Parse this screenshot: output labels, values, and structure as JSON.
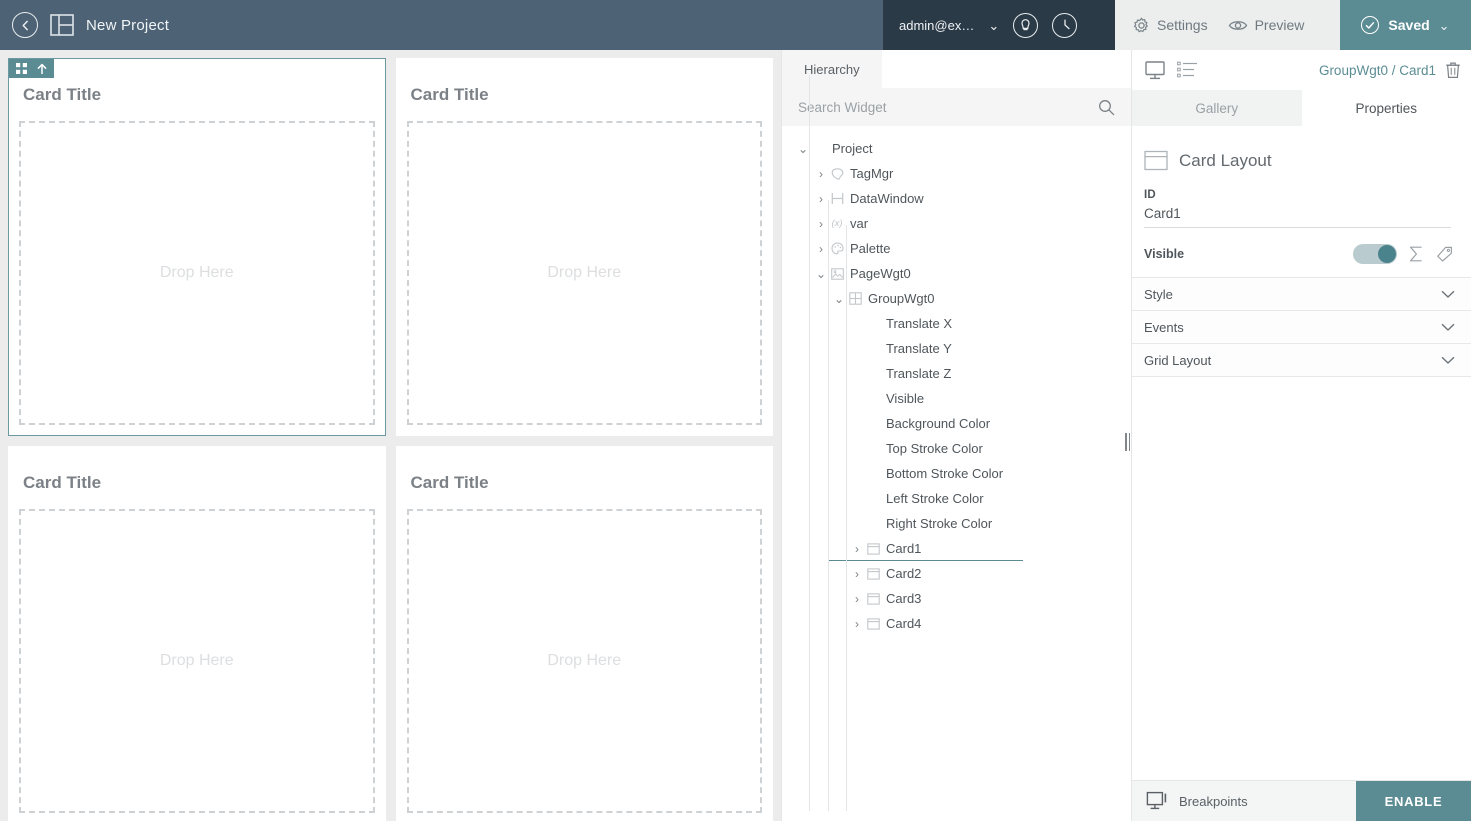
{
  "header": {
    "back_icon": "back-circle-icon",
    "layout_icon": "panel-layout-icon",
    "project_title": "New Project",
    "user_email": "admin@ex…",
    "user_chevron": "⌄",
    "help_icon": "help-circle-icon",
    "history_icon": "clock-icon",
    "settings_label": "Settings",
    "preview_label": "Preview",
    "saved_label": "Saved",
    "saved_chevron": "⌄",
    "colors": {
      "left_bar": "#4d6274",
      "user_bar": "#2b3a47",
      "tools_bar": "#eceded",
      "saved_bar": "#5b8c94"
    }
  },
  "canvas": {
    "background": "#ececec",
    "selection_color": "#5b8c94",
    "card_toolbar": {
      "move_icon": "move-resize-icon",
      "up_icon": "arrow-up-icon"
    },
    "cards": [
      {
        "title": "Card Title",
        "drop_text": "Drop Here",
        "selected": true
      },
      {
        "title": "Card Title",
        "drop_text": "Drop Here",
        "selected": false
      },
      {
        "title": "Card Title",
        "drop_text": "Drop Here",
        "selected": false
      },
      {
        "title": "Card Title",
        "drop_text": "Drop Here",
        "selected": false
      }
    ]
  },
  "hierarchy": {
    "tab_label": "Hierarchy",
    "search_placeholder": "Search Widget",
    "search_value": "",
    "search_icon": "search-icon",
    "tree": [
      {
        "label": "Project",
        "depth": 0,
        "arrow": "⌄",
        "icon": "none",
        "selected": false
      },
      {
        "label": "TagMgr",
        "depth": 1,
        "arrow": "›",
        "icon": "tag-icon",
        "selected": false
      },
      {
        "label": "DataWindow",
        "depth": 1,
        "arrow": "›",
        "icon": "window-icon",
        "selected": false
      },
      {
        "label": "var",
        "depth": 1,
        "arrow": "›",
        "icon": "var-icon",
        "selected": false
      },
      {
        "label": "Palette",
        "depth": 1,
        "arrow": "›",
        "icon": "palette-icon",
        "selected": false
      },
      {
        "label": "PageWgt0",
        "depth": 1,
        "arrow": "⌄",
        "icon": "page-icon",
        "selected": false
      },
      {
        "label": "GroupWgt0",
        "depth": 2,
        "arrow": "⌄",
        "icon": "grid-icon",
        "selected": false
      },
      {
        "label": "Translate X",
        "depth": 3,
        "arrow": "",
        "icon": "none",
        "selected": false
      },
      {
        "label": "Translate Y",
        "depth": 3,
        "arrow": "",
        "icon": "none",
        "selected": false
      },
      {
        "label": "Translate Z",
        "depth": 3,
        "arrow": "",
        "icon": "none",
        "selected": false
      },
      {
        "label": "Visible",
        "depth": 3,
        "arrow": "",
        "icon": "none",
        "selected": false
      },
      {
        "label": "Background Color",
        "depth": 3,
        "arrow": "",
        "icon": "none",
        "selected": false
      },
      {
        "label": "Top Stroke Color",
        "depth": 3,
        "arrow": "",
        "icon": "none",
        "selected": false
      },
      {
        "label": "Bottom Stroke Color",
        "depth": 3,
        "arrow": "",
        "icon": "none",
        "selected": false
      },
      {
        "label": "Left Stroke Color",
        "depth": 3,
        "arrow": "",
        "icon": "none",
        "selected": false
      },
      {
        "label": "Right Stroke Color",
        "depth": 3,
        "arrow": "",
        "icon": "none",
        "selected": false
      },
      {
        "label": "Card1",
        "depth": 3,
        "arrow": "›",
        "icon": "card-icon",
        "selected": true
      },
      {
        "label": "Card2",
        "depth": 3,
        "arrow": "›",
        "icon": "card-icon",
        "selected": false
      },
      {
        "label": "Card3",
        "depth": 3,
        "arrow": "›",
        "icon": "card-icon",
        "selected": false
      },
      {
        "label": "Card4",
        "depth": 3,
        "arrow": "›",
        "icon": "card-icon",
        "selected": false
      }
    ],
    "divider_icon": "panel-resize-handle"
  },
  "properties": {
    "device_icon": "monitor-icon",
    "list_icon": "property-list-icon",
    "breadcrumb": "GroupWgt0 / Card1",
    "delete_icon": "trash-icon",
    "tabs": [
      {
        "label": "Gallery",
        "active": false
      },
      {
        "label": "Properties",
        "active": true
      }
    ],
    "widget_icon": "card-layout-icon",
    "widget_name": "Card Layout",
    "id_label": "ID",
    "id_value": "Card1",
    "visible_label": "Visible",
    "visible_on": true,
    "sigma_icon": "sigma-icon",
    "tag_icon": "tag-icon",
    "sections": [
      {
        "label": "Style",
        "chevron": "⌄"
      },
      {
        "label": "Events",
        "chevron": "⌄"
      },
      {
        "label": "Grid Layout",
        "chevron": "⌄"
      }
    ],
    "breakpoints_label": "Breakpoints",
    "breakpoints_icon": "breakpoint-monitor-icon",
    "enable_label": "ENABLE",
    "accent_color": "#5b8c94"
  }
}
